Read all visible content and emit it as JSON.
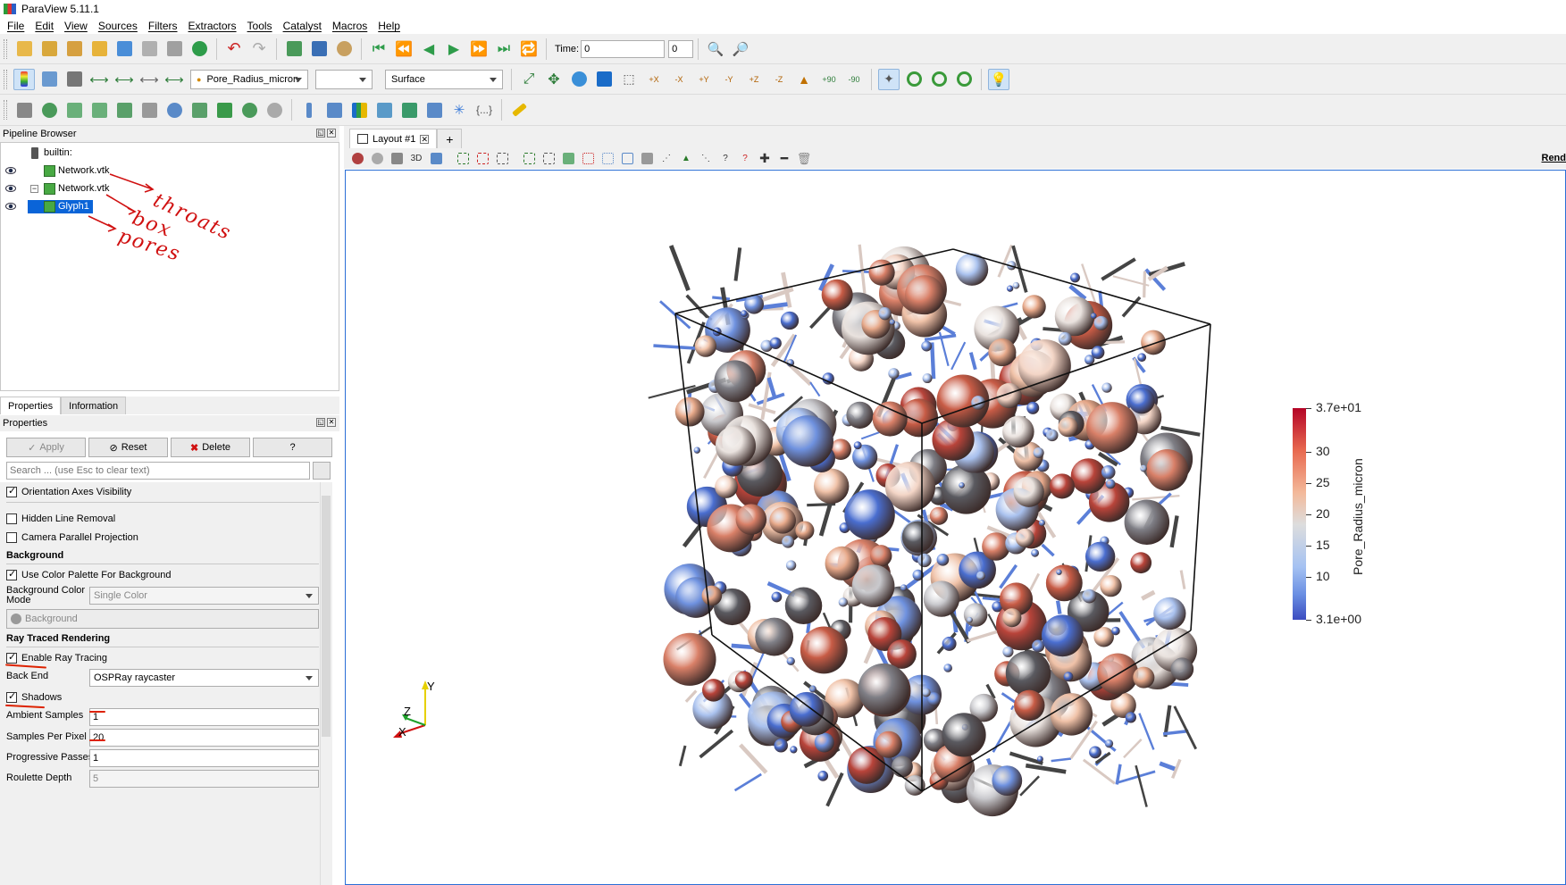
{
  "window": {
    "title": "ParaView 5.11.1"
  },
  "menubar": [
    "File",
    "Edit",
    "View",
    "Sources",
    "Filters",
    "Extractors",
    "Tools",
    "Catalyst",
    "Macros",
    "Help"
  ],
  "toolbar1": {
    "time_label": "Time:",
    "time_value": "0",
    "time_step": "0"
  },
  "toolbar2": {
    "color_array": "Pore_Radius_micron",
    "component": "",
    "representation": "Surface"
  },
  "toolbar_camera_labels": [
    "+X",
    "-X",
    "+Y",
    "-Y",
    "+Z",
    "-Z",
    "+90",
    "-90"
  ],
  "toolbar3_braces": "{...}",
  "pipeline": {
    "title": "Pipeline Browser",
    "root": "builtin:",
    "items": [
      "Network.vtk",
      "Network.vtk",
      "Glyph1"
    ]
  },
  "annotations": {
    "throats": "throats",
    "box": "box",
    "pores": "pores"
  },
  "properties": {
    "tabs": [
      "Properties",
      "Information"
    ],
    "header": "Properties",
    "buttons": {
      "apply": "Apply",
      "reset": "Reset",
      "delete": "Delete",
      "help": "?"
    },
    "search_placeholder": "Search ... (use Esc to clear text)",
    "orientation_axes": "Orientation Axes Visibility",
    "hidden_line_removal": "Hidden Line Removal",
    "camera_parallel_projection": "Camera Parallel Projection",
    "background_section": "Background",
    "use_color_palette": "Use Color Palette For Background",
    "background_color_mode_label": "Background Color Mode",
    "background_color_mode_value": "Single Color",
    "background_button": "Background",
    "ray_traced_section": "Ray Traced Rendering",
    "enable_ray_tracing": "Enable Ray Tracing",
    "back_end_label": "Back End",
    "back_end_value": "OSPRay raycaster",
    "shadows": "Shadows",
    "ambient_samples_label": "Ambient Samples",
    "ambient_samples_value": "1",
    "samples_per_pixel_label": "Samples Per Pixel",
    "samples_per_pixel_value": "20",
    "progressive_passes_label": "Progressive Passes",
    "progressive_passes_value": "1",
    "roulette_depth_label": "Roulette Depth",
    "roulette_depth_value": "5"
  },
  "layout": {
    "tab_label": "Layout #1",
    "add_tab": "+",
    "view_toolbar_3d": "3D",
    "render_view_label": "Rend"
  },
  "legend": {
    "title": "Pore_Radius_micron",
    "labels": [
      "3.7e+01",
      "30",
      "25",
      "20",
      "15",
      "10",
      "3.1e+00"
    ],
    "range": [
      3.1,
      37
    ]
  },
  "axes": {
    "x": "X",
    "y": "Y",
    "z": "Z"
  },
  "colors": {
    "selection": "#0a64d8",
    "annotation_red": "#d01010",
    "legend_high": "#b40426",
    "legend_low": "#3b4cc0"
  }
}
